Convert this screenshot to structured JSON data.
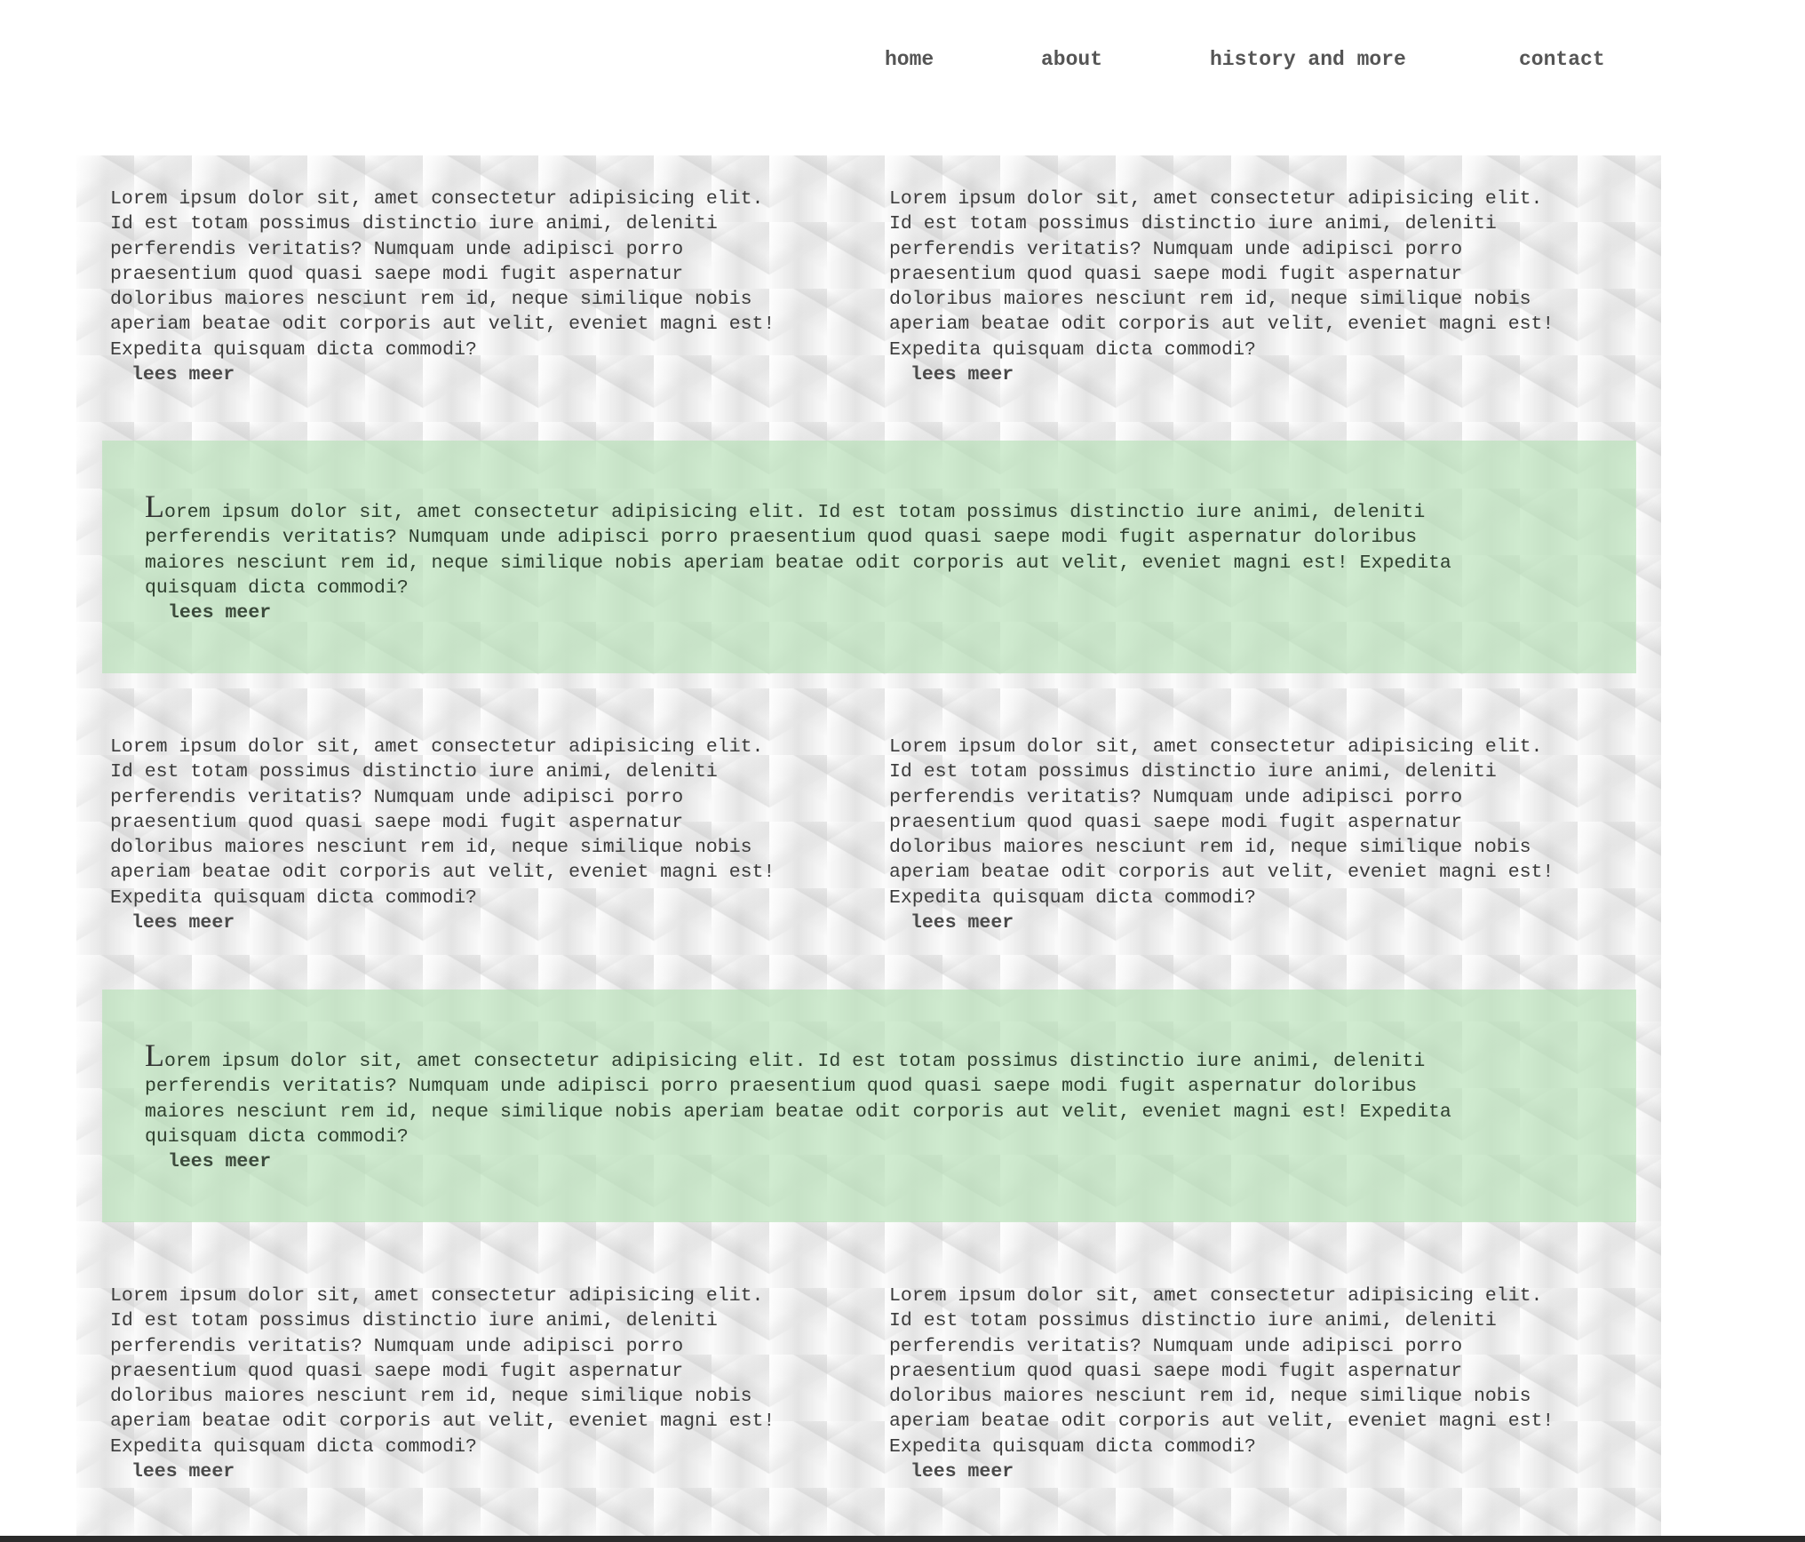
{
  "nav": {
    "home": "home",
    "about": "about",
    "history": "history and more",
    "contact": "contact"
  },
  "colors": {
    "band": "#b4e1b4",
    "text": "#3b3b3b",
    "page_background": "#ffffff"
  },
  "blocks": {
    "row1": {
      "left": {
        "text": "Lorem ipsum dolor sit, amet consectetur adipisicing elit.\nId est totam possimus distinctio iure animi, deleniti\nperferendis veritatis? Numquam unde adipisci porro\npraesentium quod quasi saepe modi fugit aspernatur\ndoloribus maiores nesciunt rem id, neque similique nobis\naperiam beatae odit corporis aut velit, eveniet magni est!\nExpedita quisquam dicta commodi?",
        "more": "lees meer"
      },
      "right": {
        "text": "Lorem ipsum dolor sit, amet consectetur adipisicing elit.\nId est totam possimus distinctio iure animi, deleniti\nperferendis veritatis? Numquam unde adipisci porro\npraesentium quod quasi saepe modi fugit aspernatur\ndoloribus maiores nesciunt rem id, neque similique nobis\naperiam beatae odit corporis aut velit, eveniet magni est!\nExpedita quisquam dicta commodi?",
        "more": "lees meer"
      }
    },
    "band1": {
      "dropcap": "L",
      "text": "orem ipsum dolor sit, amet consectetur adipisicing elit. Id est totam possimus distinctio iure animi, deleniti\nperferendis veritatis? Numquam unde adipisci porro praesentium quod quasi saepe modi fugit aspernatur doloribus\nmaiores nesciunt rem id, neque similique nobis aperiam beatae odit corporis aut velit, eveniet magni est! Expedita\nquisquam dicta commodi?",
      "more": "lees meer"
    },
    "row2": {
      "left": {
        "text": "Lorem ipsum dolor sit, amet consectetur adipisicing elit.\nId est totam possimus distinctio iure animi, deleniti\nperferendis veritatis? Numquam unde adipisci porro\npraesentium quod quasi saepe modi fugit aspernatur\ndoloribus maiores nesciunt rem id, neque similique nobis\naperiam beatae odit corporis aut velit, eveniet magni est!\nExpedita quisquam dicta commodi?",
        "more": "lees meer"
      },
      "right": {
        "text": "Lorem ipsum dolor sit, amet consectetur adipisicing elit.\nId est totam possimus distinctio iure animi, deleniti\nperferendis veritatis? Numquam unde adipisci porro\npraesentium quod quasi saepe modi fugit aspernatur\ndoloribus maiores nesciunt rem id, neque similique nobis\naperiam beatae odit corporis aut velit, eveniet magni est!\nExpedita quisquam dicta commodi?",
        "more": "lees meer"
      }
    },
    "band2": {
      "dropcap": "L",
      "text": "orem ipsum dolor sit, amet consectetur adipisicing elit. Id est totam possimus distinctio iure animi, deleniti\nperferendis veritatis? Numquam unde adipisci porro praesentium quod quasi saepe modi fugit aspernatur doloribus\nmaiores nesciunt rem id, neque similique nobis aperiam beatae odit corporis aut velit, eveniet magni est! Expedita\nquisquam dicta commodi?",
      "more": "lees meer"
    },
    "row3": {
      "left": {
        "text": "Lorem ipsum dolor sit, amet consectetur adipisicing elit.\nId est totam possimus distinctio iure animi, deleniti\nperferendis veritatis? Numquam unde adipisci porro\npraesentium quod quasi saepe modi fugit aspernatur\ndoloribus maiores nesciunt rem id, neque similique nobis\naperiam beatae odit corporis aut velit, eveniet magni est!\nExpedita quisquam dicta commodi?",
        "more": "lees meer"
      },
      "right": {
        "text": "Lorem ipsum dolor sit, amet consectetur adipisicing elit.\nId est totam possimus distinctio iure animi, deleniti\nperferendis veritatis? Numquam unde adipisci porro\npraesentium quod quasi saepe modi fugit aspernatur\ndoloribus maiores nesciunt rem id, neque similique nobis\naperiam beatae odit corporis aut velit, eveniet magni est!\nExpedita quisquam dicta commodi?",
        "more": "lees meer"
      }
    }
  }
}
